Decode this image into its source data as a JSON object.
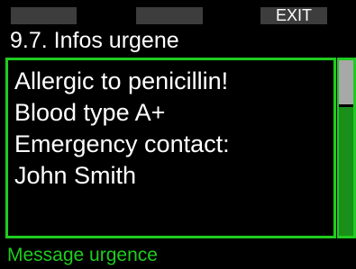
{
  "softkeys": {
    "left_label": "",
    "center_label": "",
    "right_label": "EXIT"
  },
  "header": {
    "title": "9.7. Infos urgene"
  },
  "message": {
    "lines": [
      "Allergic to penicillin!",
      "Blood type A+",
      "Emergency contact:",
      "John Smith"
    ]
  },
  "scrollbar": {
    "position_fraction": 0.0,
    "visible_fraction": 0.25
  },
  "footer": {
    "status_text": "Message urgence"
  },
  "colors": {
    "background": "#000000",
    "accent_green": "#1fcc1f",
    "scroll_track": "#1a8f1a",
    "scroll_thumb": "#a8a8a8",
    "softkey_bg": "#3d3d3d",
    "text": "#ffffff"
  }
}
